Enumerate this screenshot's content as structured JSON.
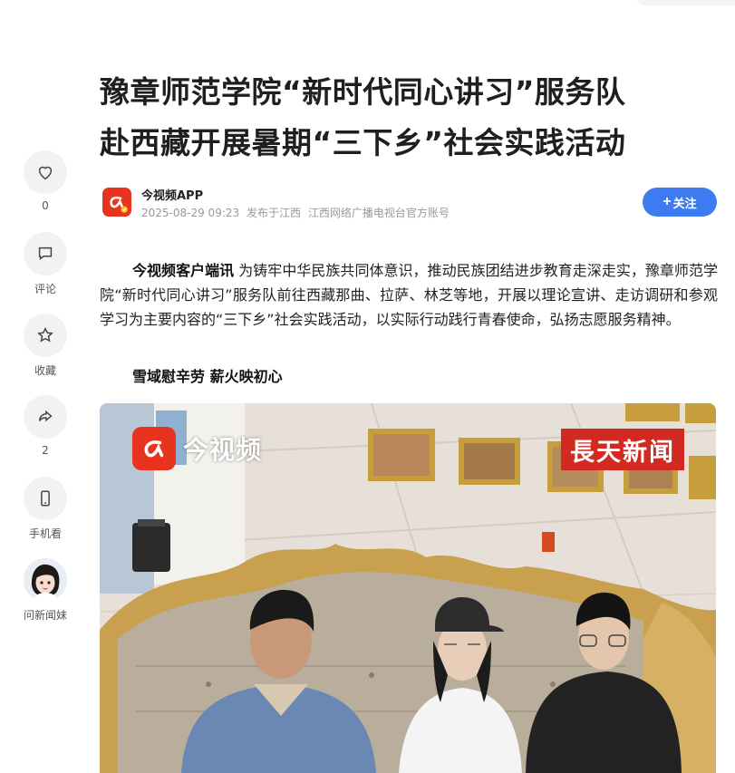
{
  "article": {
    "title_line1": "豫章师范学院“新时代同心讲习”服务队",
    "title_line2": "赴西藏开展暑期“三下乡”社会实践活动",
    "author_name": "今视频APP",
    "publish_time": "2025-08-29 09:23",
    "publish_location": "发布于江西",
    "account_desc": "江西网络广播电视台官方账号",
    "follow_label": "关注",
    "lead_source": "今视频客户端讯",
    "lead_text": " 为铸牢中华民族共同体意识，推动民族团结进步教育走深走实，豫章师范学院“新时代同心讲习”服务队前往西藏那曲、拉萨、林芝等地，开展以理论宣讲、走访调研和参观学习为主要内容的“三下乡”社会实践活动，以实际行动践行青春使命，弘扬志愿服务精神。",
    "subheading": "雪域慰辛劳  薪火映初心"
  },
  "photo": {
    "watermark_left": "今视频",
    "watermark_right": "長天新闻"
  },
  "rail": {
    "like_count": "0",
    "comment_label": "评论",
    "collect_label": "收藏",
    "share_count": "2",
    "mobile_label": "手机看",
    "assistant_label": "问新闻妹"
  },
  "colors": {
    "follow_button": "#3d7bf0",
    "brand_red": "#e8341f"
  },
  "icons": [
    "heart-icon",
    "comment-icon",
    "star-icon",
    "share-icon",
    "phone-icon",
    "plus-icon"
  ]
}
